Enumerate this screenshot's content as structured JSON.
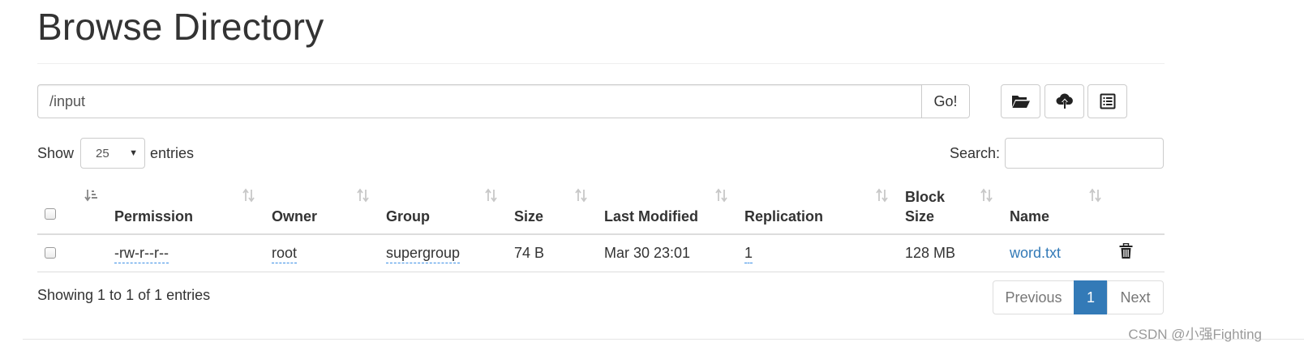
{
  "page": {
    "title": "Browse Directory"
  },
  "path_bar": {
    "value": "/input",
    "go_label": "Go!"
  },
  "toolbar": {
    "buttons": [
      {
        "icon": "folder-open-icon"
      },
      {
        "icon": "cloud-upload-icon"
      },
      {
        "icon": "list-alt-icon"
      }
    ]
  },
  "length_control": {
    "prefix": "Show",
    "selected": "25",
    "suffix": "entries"
  },
  "search": {
    "label": "Search:",
    "value": ""
  },
  "table": {
    "headers": {
      "permission": "Permission",
      "owner": "Owner",
      "group": "Group",
      "size": "Size",
      "last_modified": "Last Modified",
      "replication": "Replication",
      "block_size_line1": "Block",
      "block_size_line2": "Size",
      "name": "Name"
    },
    "rows": [
      {
        "permission": "-rw-r--r--",
        "owner": "root",
        "group": "supergroup",
        "size": "74 B",
        "last_modified": "Mar 30 23:01",
        "replication": "1",
        "block_size": "128 MB",
        "name": "word.txt"
      }
    ]
  },
  "info": {
    "text": "Showing 1 to 1 of 1 entries"
  },
  "pagination": {
    "previous": "Previous",
    "current": "1",
    "next": "Next"
  },
  "watermark": {
    "text": "CSDN @小强Fighting"
  },
  "colors": {
    "accent": "#337ab7",
    "border": "#dddddd",
    "text": "#333333"
  }
}
